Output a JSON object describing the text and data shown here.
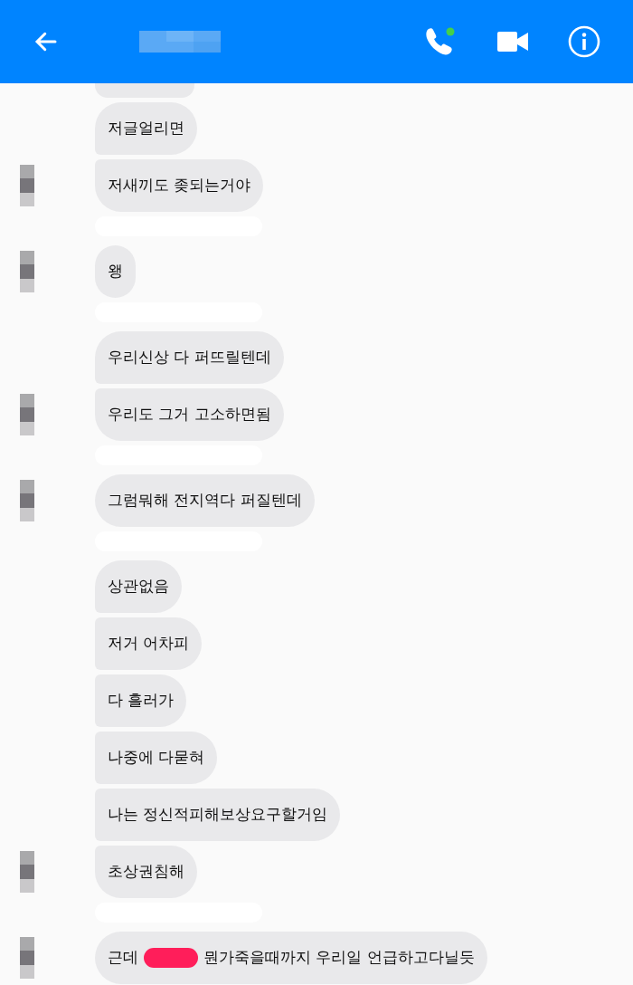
{
  "header": {
    "online": true
  },
  "groups": [
    {
      "messages": [
        {
          "text": "저글얼리면"
        },
        {
          "text": "저새끼도 좆되는거야"
        }
      ]
    },
    {
      "messages": [
        {
          "text": "왱"
        }
      ]
    },
    {
      "messages": [
        {
          "text": "우리신상 다 퍼뜨릴텐데"
        },
        {
          "text": "우리도 그거 고소하면됨"
        }
      ]
    },
    {
      "messages": [
        {
          "text": "그럼뭐해 전지역다 퍼질텐데"
        }
      ]
    },
    {
      "messages": [
        {
          "text": "상관없음"
        },
        {
          "text": "저거 어차피"
        },
        {
          "text": "다 흘러가"
        },
        {
          "text": "나중에 다묻혀"
        },
        {
          "text": "나는 정신적피해보상요구할거임"
        },
        {
          "text": "초상권침해"
        }
      ]
    },
    {
      "messages": [
        {
          "text": "근데",
          "redacted_after": true,
          "rest": "뭔가죽을때까지 우리일 언급하고다닐듯"
        }
      ]
    }
  ]
}
